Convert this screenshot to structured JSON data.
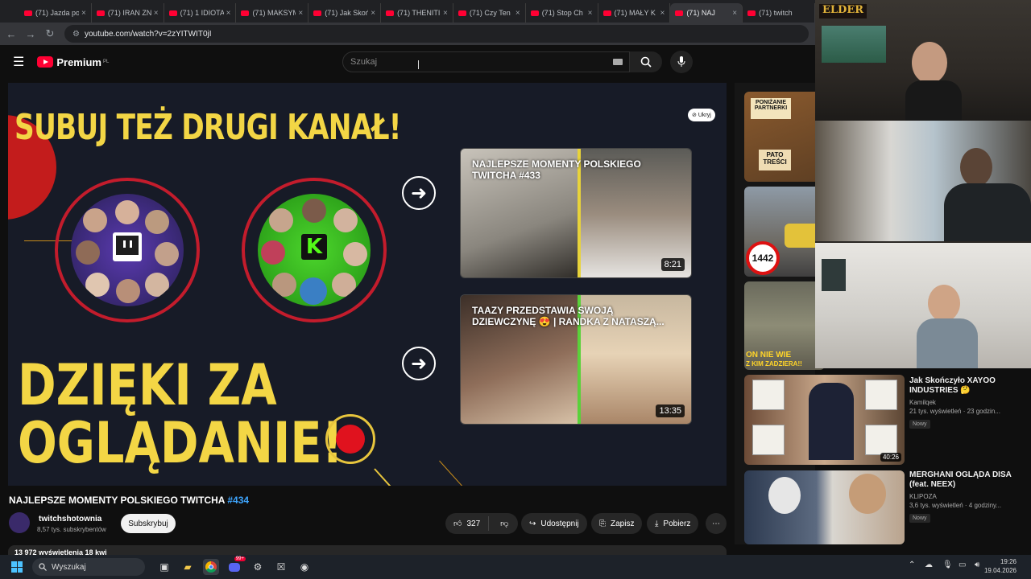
{
  "browser": {
    "tabs": [
      {
        "title": "(71) Jazda po"
      },
      {
        "title": "(71) IRAN ZN"
      },
      {
        "title": "(71) 1 IDIOTA"
      },
      {
        "title": "(71) MAKSYM"
      },
      {
        "title": "(71) Jak Skoń"
      },
      {
        "title": "(71) THENITI"
      },
      {
        "title": "(71) Czy Ten"
      },
      {
        "title": "(71) Stop Ch"
      },
      {
        "title": "(71) MAŁY K"
      },
      {
        "title": "(71) NAJ"
      },
      {
        "title": "(71) twitch"
      }
    ],
    "close_glyph": "×",
    "url": "youtube.com/watch?v=2zYITWIT0jI"
  },
  "youtube": {
    "logo": "Premium",
    "logo_region": "PL",
    "search_placeholder": "Szukaj"
  },
  "endscreen": {
    "headline": "SUBUJ TEŻ DRUGI KANAŁ!",
    "thanks_line1": "DZIĘKI ZA",
    "thanks_line2": "OGLĄDANIE!",
    "hide_label": "Ukryj",
    "cards": [
      {
        "title": "NAJLEPSZE MOMENTY POLSKIEGO TWITCHA #433",
        "duration": "8:21"
      },
      {
        "title": "TAAZY PRZEDSTAWIA SWOJĄ DZIEWCZYNĘ 😍 | RANDKA Z NATASZĄ...",
        "duration": "13:35"
      }
    ]
  },
  "video": {
    "title": "NAJLEPSZE MOMENTY POLSKIEGO TWITCHA",
    "title_tag": "#434",
    "channel": "twitchshotownia",
    "subscribers": "8,57 tys. subskrybentów",
    "subscribe_label": "Subskrybuj",
    "likes": "327",
    "share_label": "Udostępnij",
    "save_label": "Zapisz",
    "download_label": "Pobierz",
    "views_partial": "13 972 wyświetlenia  18 kwi"
  },
  "sidebar": {
    "thumb_texts": [
      "PONIŻANIE PARTNERKI",
      "PATO TREŚCI",
      "1442",
      "ON NIE WIE",
      "Z KIM ZADZIERA!!"
    ],
    "items": [
      {
        "title": "Jak Skończyło XAYOO INDUSTRIES 🤔",
        "channel": "Kamilqek",
        "meta": "21 tys. wyświetleń · 23 godzin...",
        "badge": "Nowy",
        "duration": "40:26"
      },
      {
        "title": "MERGHANI OGLĄDA DISA (feat. NEEX)",
        "channel": "KLIPOZA",
        "meta": "3,6 tys. wyświetleń · 4 godziny...",
        "badge": "Nowy"
      }
    ]
  },
  "stream_overlay": {
    "tag": "ELDER"
  },
  "taskbar": {
    "search_label": "Wyszukaj",
    "notification_count": "99+",
    "time": "19:26",
    "date": "19.04.2026"
  },
  "colors": {
    "accent_red": "#ff0033",
    "headline_yellow": "#f3d645",
    "link_blue": "#3ea6ff"
  }
}
